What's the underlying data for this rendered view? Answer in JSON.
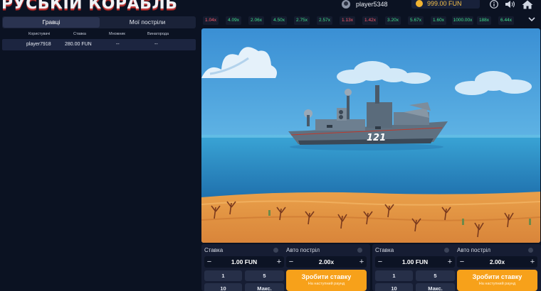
{
  "header": {
    "logo": "РУСЬКІЙ КОРАБЛЬ",
    "username": "player5348",
    "balance": "999.00 FUN",
    "icons": [
      "user-icon",
      "coin-icon",
      "info-icon",
      "sound-icon",
      "home-icon"
    ]
  },
  "left": {
    "tabs": [
      "Гравці",
      "Мої постріли"
    ],
    "table_headers": [
      "Користувачі",
      "Ставка",
      "Множник",
      "Винагорода"
    ],
    "rows": [
      {
        "user": "player7918",
        "bet": "280.00 FUN",
        "multiplier": "--",
        "reward": "--"
      }
    ]
  },
  "multipliers": [
    {
      "value": "1.04x",
      "color": "red"
    },
    {
      "value": "4.09x",
      "color": "green"
    },
    {
      "value": "2.06x",
      "color": "green"
    },
    {
      "value": "4.50x",
      "color": "green"
    },
    {
      "value": "2.75x",
      "color": "green"
    },
    {
      "value": "2.57x",
      "color": "green"
    },
    {
      "value": "1.13x",
      "color": "red"
    },
    {
      "value": "1.42x",
      "color": "red"
    },
    {
      "value": "3.20x",
      "color": "green"
    },
    {
      "value": "5.67x",
      "color": "green"
    },
    {
      "value": "1.60x",
      "color": "green"
    },
    {
      "value": "1000.00x",
      "color": "green"
    },
    {
      "value": "188x",
      "color": "green"
    },
    {
      "value": "6.44x",
      "color": "green"
    }
  ],
  "game": {
    "ship_number": "121"
  },
  "bet_panels": [
    {
      "stake_label": "Ставка",
      "stake_value": "1.00 FUN",
      "auto_label": "Авто постріл",
      "auto_value": "2.00x",
      "quick": [
        "1",
        "5",
        "10",
        "Макс."
      ],
      "button_main": "Зробити ставку",
      "button_sub": "На наступний раунд"
    },
    {
      "stake_label": "Ставка",
      "stake_value": "1.00 FUN",
      "auto_label": "Авто постріл",
      "auto_value": "2.00x",
      "quick": [
        "1",
        "5",
        "10",
        "Макс."
      ],
      "button_main": "Зробити ставку",
      "button_sub": "На наступний раунд"
    }
  ],
  "colors": {
    "background": "#0b1222",
    "accent_orange": "#f7a11a",
    "red_multiplier": "#ff5a6b",
    "green_multiplier": "#3ee08c",
    "balance_gold": "#f5c14a"
  }
}
